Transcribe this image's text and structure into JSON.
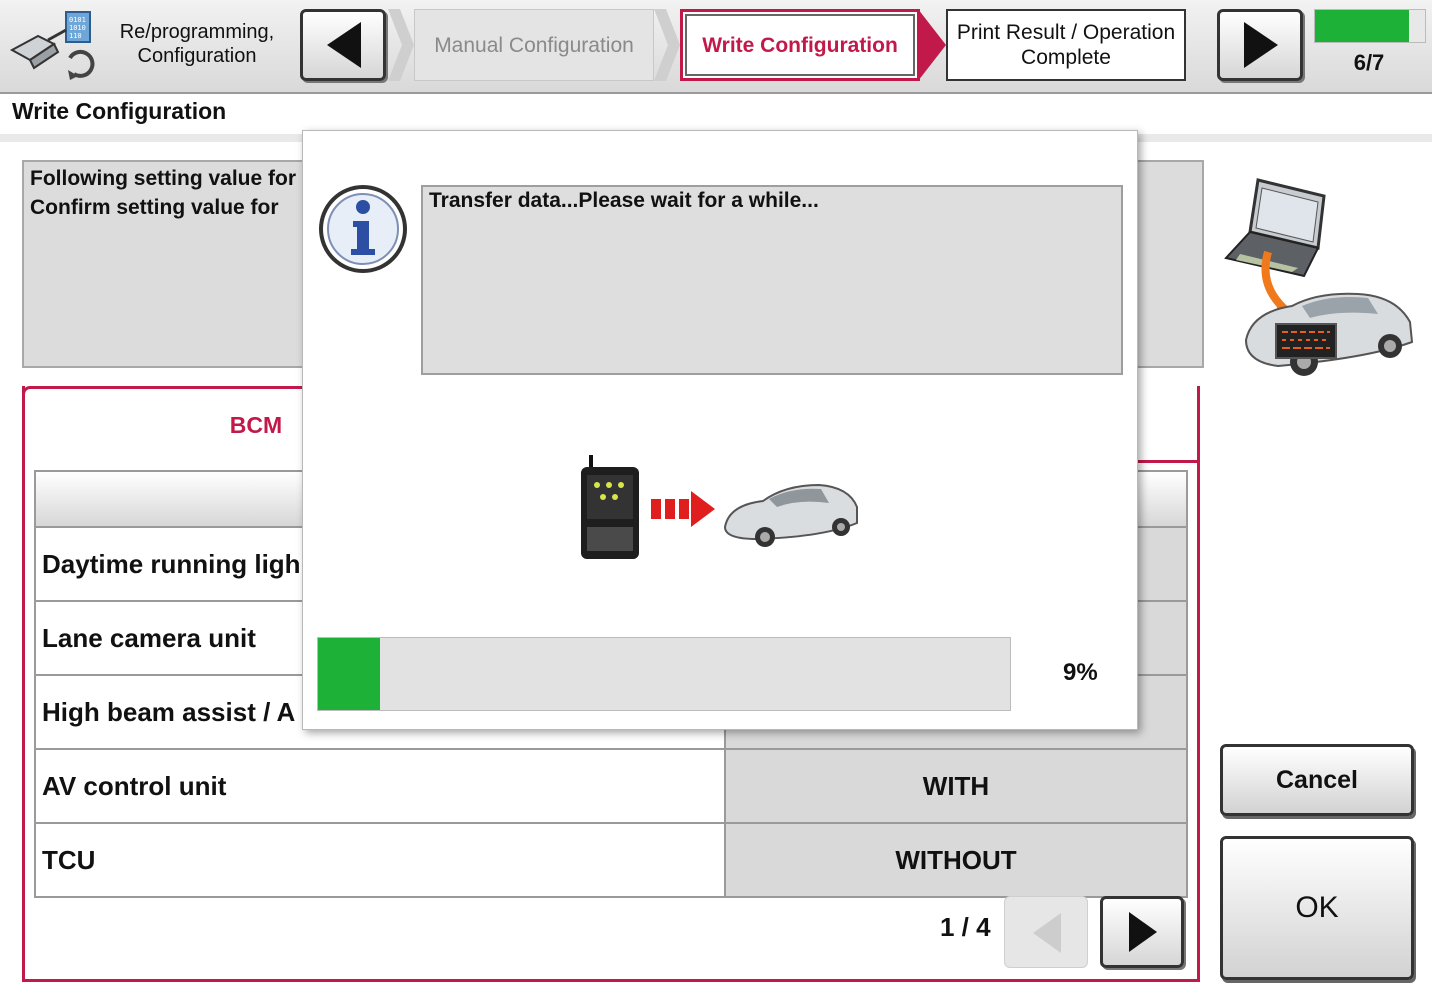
{
  "header": {
    "app_title": "Re/programming, Configuration",
    "back_icon": "left-arrow-icon",
    "steps": [
      {
        "label": "Manual Configuration",
        "state": "inactive"
      },
      {
        "label": "Write Configuration",
        "state": "active"
      },
      {
        "label": "Print Result / Operation Complete",
        "state": "next"
      }
    ],
    "forward_icon": "right-arrow-icon",
    "step_progress": 0.857,
    "step_counter": "6/7"
  },
  "page": {
    "title": "Write Configuration",
    "message_line1": "Following setting value for",
    "message_line2": "Confirm setting value for"
  },
  "panel": {
    "tab_label": "BCM",
    "rows": [
      {
        "name": "Daytime running ligh",
        "value": ""
      },
      {
        "name": "Lane camera unit",
        "value": ""
      },
      {
        "name": "High beam assist / A",
        "value": ""
      },
      {
        "name": "AV control unit",
        "value": "WITH"
      },
      {
        "name": "TCU",
        "value": "WITHOUT"
      }
    ],
    "pager": "1 / 4"
  },
  "buttons": {
    "cancel": "Cancel",
    "ok": "OK"
  },
  "dialog": {
    "icon": "info-icon",
    "message": "Transfer data...Please wait for a while...",
    "progress": 0.09,
    "progress_label": "9%"
  },
  "colors": {
    "accent": "#c2194b",
    "progress": "#1db137"
  }
}
